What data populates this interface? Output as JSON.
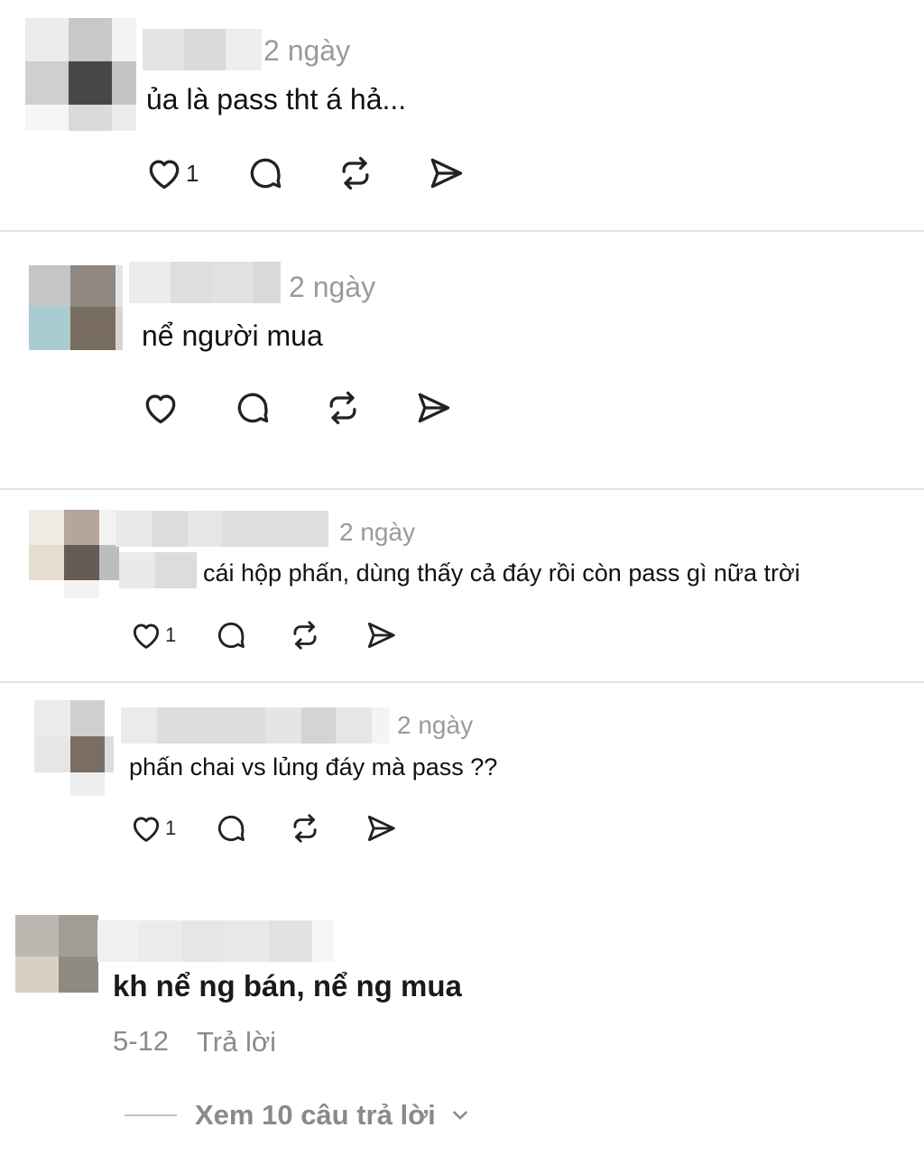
{
  "comments": [
    {
      "time": "2 ngày",
      "text": "ủa là pass tht á hả...",
      "like_count": "1"
    },
    {
      "time": "2 ngày",
      "text": "nể người mua",
      "like_count": ""
    },
    {
      "time": "2 ngày",
      "text": "cái hộp phấn, dùng thấy cả đáy rồi còn pass gì nữa trời",
      "like_count": "1"
    },
    {
      "time": "2 ngày",
      "text": "phấn chai vs lủng đáy mà pass ??",
      "like_count": "1"
    }
  ],
  "last_comment": {
    "text": "kh nể ng bán, nể ng mua",
    "date": "5-12",
    "reply_label": "Trả lời",
    "view_replies_label": "Xem 10 câu trả lời"
  },
  "icons": [
    "heart-icon",
    "comment-icon",
    "repost-icon",
    "share-icon",
    "chevron-down-icon"
  ],
  "colors": {
    "text": "#111111",
    "meta": "#9a9a9a",
    "divider": "#e3e3e3"
  }
}
